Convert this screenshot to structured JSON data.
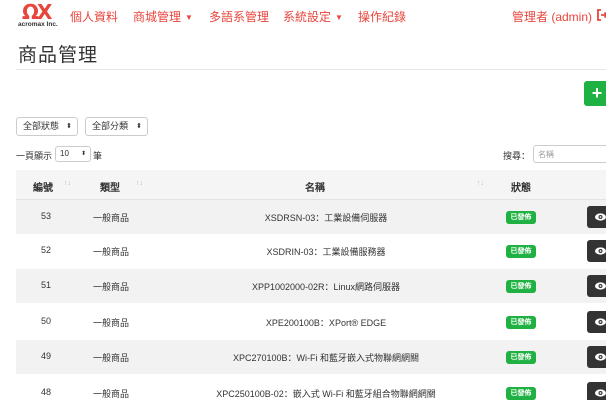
{
  "brand": {
    "mark": "ΩX",
    "name": "acromax Inc."
  },
  "nav": {
    "items": [
      {
        "label": "個人資料",
        "dropdown": false
      },
      {
        "label": "商城管理",
        "dropdown": true
      },
      {
        "label": "多語系管理",
        "dropdown": false
      },
      {
        "label": "系統設定",
        "dropdown": true
      },
      {
        "label": "操作紀錄",
        "dropdown": false
      }
    ],
    "user": "管理者 (admin)",
    "caret": "▼"
  },
  "page": {
    "title": "商品管理",
    "add_label": "+"
  },
  "filters": {
    "status": "全部狀態",
    "category": "全部分類",
    "arrows": "⬍"
  },
  "table_controls": {
    "length_before": "一頁顯示",
    "length_value": "10",
    "length_after": "筆",
    "search_label": "搜尋：",
    "search_placeholder": "名稱"
  },
  "table": {
    "headers": {
      "num": "編號",
      "type": "類型",
      "name": "名稱",
      "status": "狀態"
    },
    "sort_glyph": "↑↓",
    "rows": [
      {
        "num": "53",
        "type": "一般商品",
        "name": "XSDRSN-03：工業設備伺服器",
        "status": "已發佈"
      },
      {
        "num": "52",
        "type": "一般商品",
        "name": "XSDRIN-03：工業設備服務器",
        "status": "已發佈"
      },
      {
        "num": "51",
        "type": "一般商品",
        "name": "XPP1002000-02R：Linux網路伺服器",
        "status": "已發佈"
      },
      {
        "num": "50",
        "type": "一般商品",
        "name": "XPE200100B：XPort® EDGE",
        "status": "已發佈"
      },
      {
        "num": "49",
        "type": "一般商品",
        "name": "XPC270100B：Wi-Fi 和藍牙嵌入式物聯網網關",
        "status": "已發佈"
      },
      {
        "num": "48",
        "type": "一般商品",
        "name": "XPC250100B-02：嵌入式 Wi-Fi 和藍牙組合物聯網網關",
        "status": "已發佈"
      }
    ]
  },
  "colors": {
    "accent": "#e8453c",
    "success": "#1fb141",
    "dark_button": "#333333"
  }
}
